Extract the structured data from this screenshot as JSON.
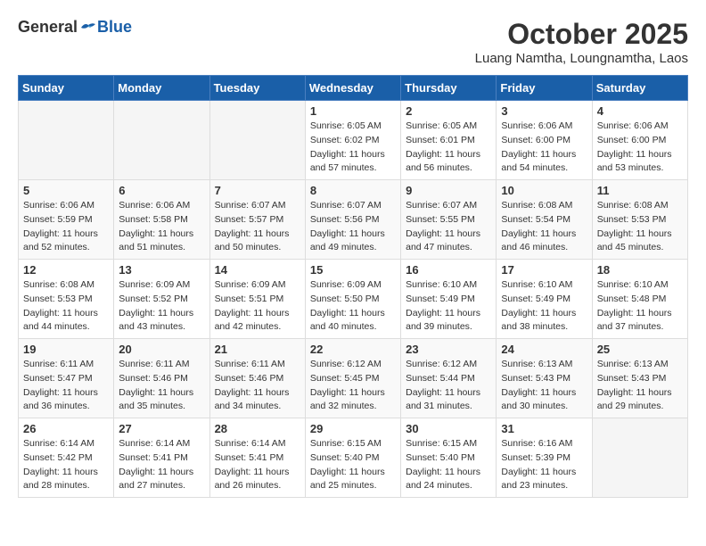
{
  "header": {
    "logo_general": "General",
    "logo_blue": "Blue",
    "title": "October 2025",
    "subtitle": "Luang Namtha, Loungnamtha, Laos"
  },
  "weekdays": [
    "Sunday",
    "Monday",
    "Tuesday",
    "Wednesday",
    "Thursday",
    "Friday",
    "Saturday"
  ],
  "weeks": [
    [
      {
        "day": "",
        "info": ""
      },
      {
        "day": "",
        "info": ""
      },
      {
        "day": "",
        "info": ""
      },
      {
        "day": "1",
        "info": "Sunrise: 6:05 AM\nSunset: 6:02 PM\nDaylight: 11 hours\nand 57 minutes."
      },
      {
        "day": "2",
        "info": "Sunrise: 6:05 AM\nSunset: 6:01 PM\nDaylight: 11 hours\nand 56 minutes."
      },
      {
        "day": "3",
        "info": "Sunrise: 6:06 AM\nSunset: 6:00 PM\nDaylight: 11 hours\nand 54 minutes."
      },
      {
        "day": "4",
        "info": "Sunrise: 6:06 AM\nSunset: 6:00 PM\nDaylight: 11 hours\nand 53 minutes."
      }
    ],
    [
      {
        "day": "5",
        "info": "Sunrise: 6:06 AM\nSunset: 5:59 PM\nDaylight: 11 hours\nand 52 minutes."
      },
      {
        "day": "6",
        "info": "Sunrise: 6:06 AM\nSunset: 5:58 PM\nDaylight: 11 hours\nand 51 minutes."
      },
      {
        "day": "7",
        "info": "Sunrise: 6:07 AM\nSunset: 5:57 PM\nDaylight: 11 hours\nand 50 minutes."
      },
      {
        "day": "8",
        "info": "Sunrise: 6:07 AM\nSunset: 5:56 PM\nDaylight: 11 hours\nand 49 minutes."
      },
      {
        "day": "9",
        "info": "Sunrise: 6:07 AM\nSunset: 5:55 PM\nDaylight: 11 hours\nand 47 minutes."
      },
      {
        "day": "10",
        "info": "Sunrise: 6:08 AM\nSunset: 5:54 PM\nDaylight: 11 hours\nand 46 minutes."
      },
      {
        "day": "11",
        "info": "Sunrise: 6:08 AM\nSunset: 5:53 PM\nDaylight: 11 hours\nand 45 minutes."
      }
    ],
    [
      {
        "day": "12",
        "info": "Sunrise: 6:08 AM\nSunset: 5:53 PM\nDaylight: 11 hours\nand 44 minutes."
      },
      {
        "day": "13",
        "info": "Sunrise: 6:09 AM\nSunset: 5:52 PM\nDaylight: 11 hours\nand 43 minutes."
      },
      {
        "day": "14",
        "info": "Sunrise: 6:09 AM\nSunset: 5:51 PM\nDaylight: 11 hours\nand 42 minutes."
      },
      {
        "day": "15",
        "info": "Sunrise: 6:09 AM\nSunset: 5:50 PM\nDaylight: 11 hours\nand 40 minutes."
      },
      {
        "day": "16",
        "info": "Sunrise: 6:10 AM\nSunset: 5:49 PM\nDaylight: 11 hours\nand 39 minutes."
      },
      {
        "day": "17",
        "info": "Sunrise: 6:10 AM\nSunset: 5:49 PM\nDaylight: 11 hours\nand 38 minutes."
      },
      {
        "day": "18",
        "info": "Sunrise: 6:10 AM\nSunset: 5:48 PM\nDaylight: 11 hours\nand 37 minutes."
      }
    ],
    [
      {
        "day": "19",
        "info": "Sunrise: 6:11 AM\nSunset: 5:47 PM\nDaylight: 11 hours\nand 36 minutes."
      },
      {
        "day": "20",
        "info": "Sunrise: 6:11 AM\nSunset: 5:46 PM\nDaylight: 11 hours\nand 35 minutes."
      },
      {
        "day": "21",
        "info": "Sunrise: 6:11 AM\nSunset: 5:46 PM\nDaylight: 11 hours\nand 34 minutes."
      },
      {
        "day": "22",
        "info": "Sunrise: 6:12 AM\nSunset: 5:45 PM\nDaylight: 11 hours\nand 32 minutes."
      },
      {
        "day": "23",
        "info": "Sunrise: 6:12 AM\nSunset: 5:44 PM\nDaylight: 11 hours\nand 31 minutes."
      },
      {
        "day": "24",
        "info": "Sunrise: 6:13 AM\nSunset: 5:43 PM\nDaylight: 11 hours\nand 30 minutes."
      },
      {
        "day": "25",
        "info": "Sunrise: 6:13 AM\nSunset: 5:43 PM\nDaylight: 11 hours\nand 29 minutes."
      }
    ],
    [
      {
        "day": "26",
        "info": "Sunrise: 6:14 AM\nSunset: 5:42 PM\nDaylight: 11 hours\nand 28 minutes."
      },
      {
        "day": "27",
        "info": "Sunrise: 6:14 AM\nSunset: 5:41 PM\nDaylight: 11 hours\nand 27 minutes."
      },
      {
        "day": "28",
        "info": "Sunrise: 6:14 AM\nSunset: 5:41 PM\nDaylight: 11 hours\nand 26 minutes."
      },
      {
        "day": "29",
        "info": "Sunrise: 6:15 AM\nSunset: 5:40 PM\nDaylight: 11 hours\nand 25 minutes."
      },
      {
        "day": "30",
        "info": "Sunrise: 6:15 AM\nSunset: 5:40 PM\nDaylight: 11 hours\nand 24 minutes."
      },
      {
        "day": "31",
        "info": "Sunrise: 6:16 AM\nSunset: 5:39 PM\nDaylight: 11 hours\nand 23 minutes."
      },
      {
        "day": "",
        "info": ""
      }
    ]
  ]
}
